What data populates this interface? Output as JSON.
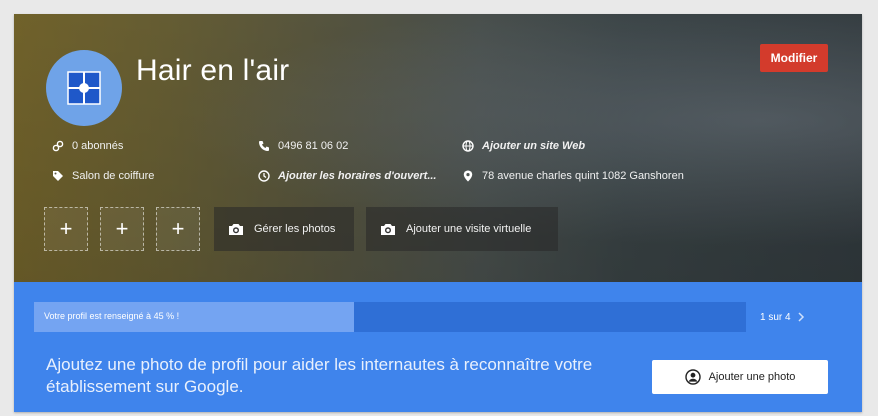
{
  "business": {
    "name": "Hair en l'air",
    "edit_label": "Modifier"
  },
  "info": {
    "subscribers": "0 abonnés",
    "category": "Salon de coiffure",
    "phone": "0496 81 06 02",
    "add_hours": "Ajouter les horaires d'ouvert...",
    "add_website": "Ajouter un site Web",
    "address": "78 avenue charles quint 1082 Ganshoren"
  },
  "photos": {
    "plus_symbol": "+",
    "manage_label": "Gérer les photos",
    "virtual_tour_label": "Ajouter une visite virtuelle"
  },
  "profile_progress": {
    "label": "Votre profil est renseigné à 45 % !",
    "percent": 45,
    "pager": "1 sur 4"
  },
  "suggestion": {
    "text": "Ajoutez une photo de profil pour aider les internautes à reconnaître votre établissement sur Google.",
    "button_label": "Ajouter une photo"
  },
  "colors": {
    "accent_red": "#d33b2c",
    "banner_blue": "#3f84ec",
    "avatar_blue": "#6fa3e8"
  }
}
